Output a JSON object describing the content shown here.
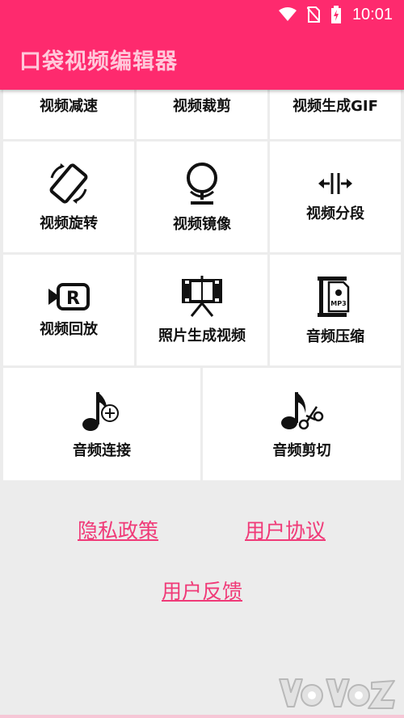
{
  "status_bar": {
    "time": "10:01",
    "icons": [
      "wifi-icon",
      "no-sim-icon",
      "battery-charging-icon"
    ]
  },
  "app_bar": {
    "title": "口袋视频编辑器",
    "color": "#fe2a6e"
  },
  "tools": [
    {
      "label": "视频减速",
      "icon": "none"
    },
    {
      "label": "视频裁剪",
      "icon": "none"
    },
    {
      "label": "视频生成GIF",
      "icon": "none"
    },
    {
      "label": "视频旋转",
      "icon": "rotate-device-icon"
    },
    {
      "label": "视频镜像",
      "icon": "mirror-icon"
    },
    {
      "label": "视频分段",
      "icon": "split-icon"
    },
    {
      "label": "视频回放",
      "icon": "replay-icon"
    },
    {
      "label": "照片生成视频",
      "icon": "film-projector-icon"
    },
    {
      "label": "音频压缩",
      "icon": "mp3-compress-icon"
    },
    {
      "label": "音频连接",
      "icon": "music-note-add-icon"
    },
    {
      "label": "音频剪切",
      "icon": "music-note-cut-icon"
    }
  ],
  "links": {
    "privacy": "隐私政策",
    "user_agreement": "用户协议",
    "feedback": "用户反馈",
    "color": "#f03a78"
  }
}
